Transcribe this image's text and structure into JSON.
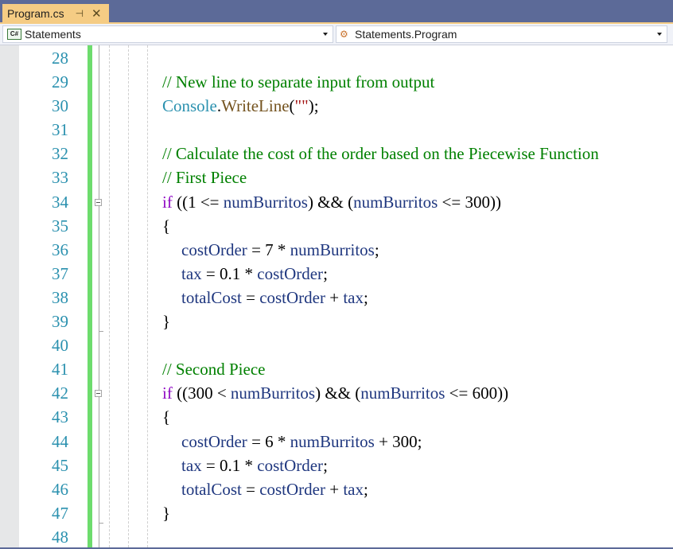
{
  "tab": {
    "title": "Program.cs",
    "pin_icon": "pin-icon",
    "close_icon": "close-icon"
  },
  "navigation": {
    "project_dropdown": {
      "icon": "csharp-project-icon",
      "value": "Statements"
    },
    "type_dropdown": {
      "icon": "class-icon",
      "value": "Statements.Program"
    }
  },
  "colors": {
    "tab_active": "#f5cc84",
    "chrome": "#5c6a98",
    "line_number": "#2b91af",
    "comment": "#008000",
    "keyword": "#8f08c4",
    "variable": "#1f377f",
    "type": "#2b91af",
    "method": "#74531f",
    "string": "#a31515",
    "change_bar": "#6ddc6d"
  },
  "editor": {
    "lines": [
      {
        "number": "28",
        "tokens": []
      },
      {
        "number": "29",
        "tokens": [
          {
            "t": "// New line to separate input from output",
            "k": "comment"
          }
        ]
      },
      {
        "number": "30",
        "tokens": [
          {
            "t": "Console",
            "k": "type"
          },
          {
            "t": ".",
            "k": "plain"
          },
          {
            "t": "WriteLine",
            "k": "method"
          },
          {
            "t": "(",
            "k": "plain"
          },
          {
            "t": "\"\"",
            "k": "string"
          },
          {
            "t": ");",
            "k": "plain"
          }
        ]
      },
      {
        "number": "31",
        "tokens": []
      },
      {
        "number": "32",
        "tokens": [
          {
            "t": "// Calculate the cost of the order based on the Piecewise Function",
            "k": "comment"
          }
        ]
      },
      {
        "number": "33",
        "tokens": [
          {
            "t": "// First Piece",
            "k": "comment"
          }
        ]
      },
      {
        "number": "34",
        "fold": true,
        "tokens": [
          {
            "t": "if",
            "k": "kw"
          },
          {
            "t": " ((1 <= ",
            "k": "plain"
          },
          {
            "t": "numBurritos",
            "k": "var"
          },
          {
            "t": ") && (",
            "k": "plain"
          },
          {
            "t": "numBurritos",
            "k": "var"
          },
          {
            "t": " <= 300))",
            "k": "plain"
          }
        ]
      },
      {
        "number": "35",
        "tokens": [
          {
            "t": "{",
            "k": "plain"
          }
        ]
      },
      {
        "number": "36",
        "indent": true,
        "tokens": [
          {
            "t": "costOrder",
            "k": "var"
          },
          {
            "t": " = 7 * ",
            "k": "plain"
          },
          {
            "t": "numBurritos",
            "k": "var"
          },
          {
            "t": ";",
            "k": "plain"
          }
        ]
      },
      {
        "number": "37",
        "indent": true,
        "tokens": [
          {
            "t": "tax",
            "k": "var"
          },
          {
            "t": " = 0.1 * ",
            "k": "plain"
          },
          {
            "t": "costOrder",
            "k": "var"
          },
          {
            "t": ";",
            "k": "plain"
          }
        ]
      },
      {
        "number": "38",
        "indent": true,
        "tokens": [
          {
            "t": "totalCost",
            "k": "var"
          },
          {
            "t": " = ",
            "k": "plain"
          },
          {
            "t": "costOrder",
            "k": "var"
          },
          {
            "t": " + ",
            "k": "plain"
          },
          {
            "t": "tax",
            "k": "var"
          },
          {
            "t": ";",
            "k": "plain"
          }
        ]
      },
      {
        "number": "39",
        "foldend": true,
        "tokens": [
          {
            "t": "}",
            "k": "plain"
          }
        ]
      },
      {
        "number": "40",
        "tokens": []
      },
      {
        "number": "41",
        "tokens": [
          {
            "t": "// Second Piece",
            "k": "comment"
          }
        ]
      },
      {
        "number": "42",
        "fold": true,
        "tokens": [
          {
            "t": "if",
            "k": "kw"
          },
          {
            "t": " ((300 < ",
            "k": "plain"
          },
          {
            "t": "numBurritos",
            "k": "var"
          },
          {
            "t": ") && (",
            "k": "plain"
          },
          {
            "t": "numBurritos",
            "k": "var"
          },
          {
            "t": " <= 600))",
            "k": "plain"
          }
        ]
      },
      {
        "number": "43",
        "tokens": [
          {
            "t": "{",
            "k": "plain"
          }
        ]
      },
      {
        "number": "44",
        "indent": true,
        "tokens": [
          {
            "t": "costOrder",
            "k": "var"
          },
          {
            "t": " = 6 * ",
            "k": "plain"
          },
          {
            "t": "numBurritos",
            "k": "var"
          },
          {
            "t": " + 300;",
            "k": "plain"
          }
        ]
      },
      {
        "number": "45",
        "indent": true,
        "tokens": [
          {
            "t": "tax",
            "k": "var"
          },
          {
            "t": " = 0.1 * ",
            "k": "plain"
          },
          {
            "t": "costOrder",
            "k": "var"
          },
          {
            "t": ";",
            "k": "plain"
          }
        ]
      },
      {
        "number": "46",
        "indent": true,
        "tokens": [
          {
            "t": "totalCost",
            "k": "var"
          },
          {
            "t": " = ",
            "k": "plain"
          },
          {
            "t": "costOrder",
            "k": "var"
          },
          {
            "t": " + ",
            "k": "plain"
          },
          {
            "t": "tax",
            "k": "var"
          },
          {
            "t": ";",
            "k": "plain"
          }
        ]
      },
      {
        "number": "47",
        "foldend": true,
        "tokens": [
          {
            "t": "}",
            "k": "plain"
          }
        ]
      },
      {
        "number": "48",
        "tokens": []
      }
    ]
  }
}
